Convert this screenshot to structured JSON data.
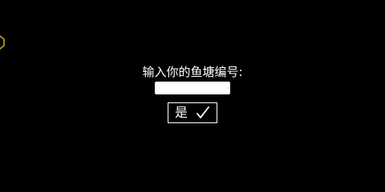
{
  "dialog": {
    "prompt": "输入你的鱼塘编号:",
    "input": {
      "value": "",
      "placeholder": ""
    },
    "confirm_label": "是"
  },
  "icons": {
    "corner": "hexagon-coin-icon",
    "confirm": "check-icon"
  },
  "colors": {
    "background": "#000000",
    "text": "#ffffff",
    "corner_icon": "#c9a227"
  }
}
